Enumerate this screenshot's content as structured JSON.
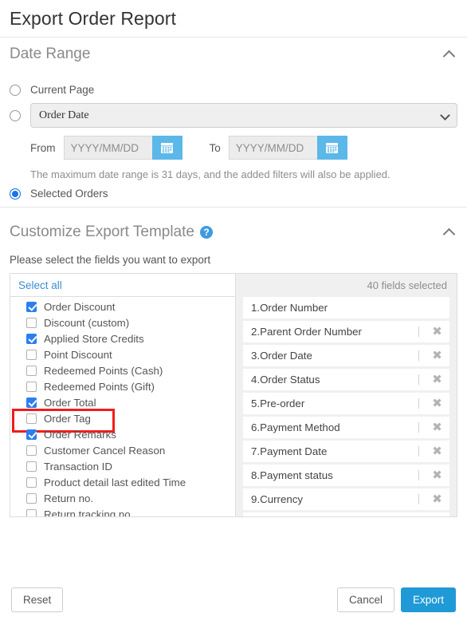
{
  "dialog": {
    "title": "Export Order Report"
  },
  "date_range": {
    "heading": "Date Range",
    "collapse_icon": "chevron-up-icon",
    "options": [
      {
        "label": "Current Page",
        "selected": false
      },
      {
        "label": "",
        "selected": false
      },
      {
        "label": "Selected Orders",
        "selected": true
      }
    ],
    "current_page_label": "Current Page",
    "selected_orders_label": "Selected Orders",
    "date_type_select": {
      "value": "Order Date",
      "options": [
        "Order Date"
      ]
    },
    "from_label": "From",
    "to_label": "To",
    "from_value": "",
    "to_value": "",
    "date_placeholder": "YYYY/MM/DD",
    "calendar_icon": "calendar-icon",
    "hint": "The maximum date range is 31 days, and the added filters will also be applied."
  },
  "customize": {
    "heading": "Customize Export Template",
    "help_icon": "help-circle-icon",
    "collapse_icon": "chevron-up-icon",
    "subtext": "Please select the fields you want to export",
    "select_all_label": "Select all",
    "fields": [
      {
        "label": "Order Discount",
        "checked": true,
        "highlighted": false
      },
      {
        "label": "Discount (custom)",
        "checked": false,
        "highlighted": false
      },
      {
        "label": "Applied Store Credits",
        "checked": true,
        "highlighted": false
      },
      {
        "label": "Point Discount",
        "checked": false,
        "highlighted": false
      },
      {
        "label": "Redeemed Points (Cash)",
        "checked": false,
        "highlighted": false
      },
      {
        "label": "Redeemed Points (Gift)",
        "checked": false,
        "highlighted": false
      },
      {
        "label": "Order Total",
        "checked": true,
        "highlighted": false
      },
      {
        "label": "Order Tag",
        "checked": false,
        "highlighted": true
      },
      {
        "label": "Order Remarks",
        "checked": true,
        "highlighted": false
      },
      {
        "label": "Customer Cancel Reason",
        "checked": false,
        "highlighted": false
      },
      {
        "label": "Transaction ID",
        "checked": false,
        "highlighted": false
      },
      {
        "label": "Product detail last edited Time",
        "checked": false,
        "highlighted": false
      },
      {
        "label": "Return no.",
        "checked": false,
        "highlighted": false
      },
      {
        "label": "Return tracking no.",
        "checked": false,
        "highlighted": false
      }
    ],
    "selected_count_label": "40 fields selected",
    "selected_fields": [
      {
        "label": "1.Order Number",
        "removable": false
      },
      {
        "label": "2.Parent Order Number",
        "removable": true
      },
      {
        "label": "3.Order Date",
        "removable": true
      },
      {
        "label": "4.Order Status",
        "removable": true
      },
      {
        "label": "5.Pre-order",
        "removable": true
      },
      {
        "label": "6.Payment Method",
        "removable": true
      },
      {
        "label": "7.Payment Date",
        "removable": true
      },
      {
        "label": "8.Payment status",
        "removable": true
      },
      {
        "label": "9.Currency",
        "removable": true
      },
      {
        "label": "",
        "removable": true
      }
    ],
    "remove_icon": "close-x-icon"
  },
  "footer": {
    "reset_label": "Reset",
    "cancel_label": "Cancel",
    "export_label": "Export"
  },
  "colors": {
    "accent": "#1f9ad6",
    "link": "#3b8fd4",
    "checkbox_checked": "#2b7ef0",
    "radio_checked": "#1a73e8",
    "calendar_button": "#5bb8e8",
    "highlight_box": "#f21c1c"
  }
}
